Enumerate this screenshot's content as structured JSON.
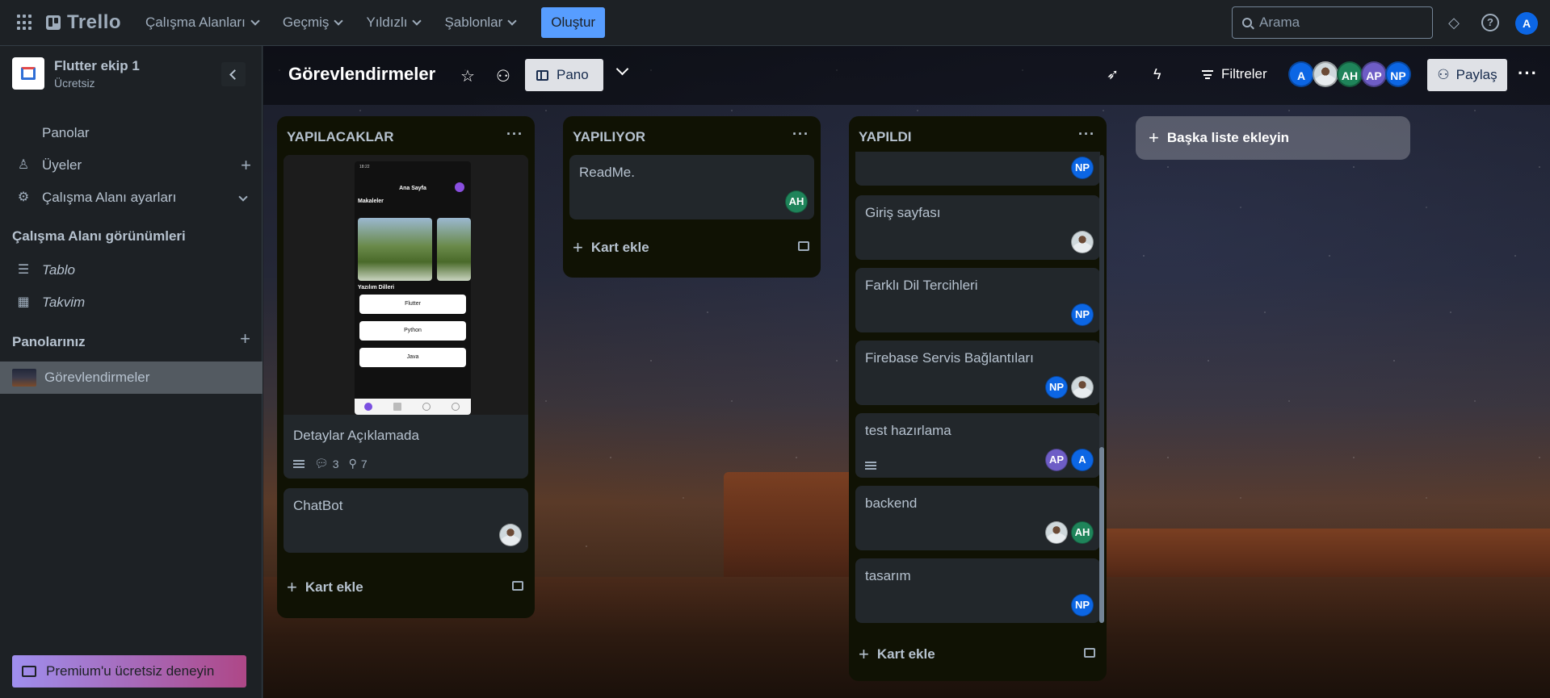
{
  "topbar": {
    "app_name": "Trello",
    "nav": [
      "Çalışma Alanları",
      "Geçmiş",
      "Yıldızlı",
      "Şablonlar"
    ],
    "create_label": "Oluştur",
    "search_placeholder": "Arama",
    "user_initial": "A"
  },
  "sidebar": {
    "workspace_name": "Flutter ekip 1",
    "workspace_plan": "Ücretsiz",
    "items": [
      "Panolar",
      "Üyeler",
      "Çalışma Alanı ayarları"
    ],
    "views_heading": "Çalışma Alanı görünümleri",
    "views": [
      "Tablo",
      "Takvim"
    ],
    "boards_heading": "Panolarınız",
    "boards": [
      "Görevlendirmeler"
    ],
    "premium_label": "Premium'u ücretsiz deneyin"
  },
  "board": {
    "title": "Görevlendirmeler",
    "view_label": "Pano",
    "filter_label": "Filtreler",
    "share_label": "Paylaş",
    "members": [
      "A",
      "",
      "AH",
      "AP",
      "NP"
    ],
    "add_list_label": "Başka liste ekleyin",
    "add_card_label": "Kart ekle"
  },
  "lists": [
    {
      "title": "YAPILACAKLAR",
      "cards": [
        {
          "title": "Detaylar Açıklamada",
          "comments": "3",
          "attachments": "7",
          "cover": {
            "status": "18:22",
            "screen_title": "Ana Sayfa",
            "section1": "Makaleler",
            "section2": "Yazılım Dilleri",
            "buttons": [
              "Flutter",
              "Python",
              "Java"
            ]
          }
        },
        {
          "title": "ChatBot",
          "members": [
            ""
          ]
        }
      ]
    },
    {
      "title": "YAPILIYOR",
      "cards": [
        {
          "title": "ReadMe.",
          "members": [
            "AH"
          ]
        }
      ]
    },
    {
      "title": "YAPILDI",
      "cards": [
        {
          "title": "",
          "members": [
            "NP"
          ]
        },
        {
          "title": "Giriş sayfası",
          "members": [
            ""
          ]
        },
        {
          "title": "Farklı Dil Tercihleri",
          "members": [
            "NP"
          ]
        },
        {
          "title": "Firebase Servis Bağlantıları",
          "members": [
            "NP",
            ""
          ]
        },
        {
          "title": "test hazırlama",
          "members": [
            "AP",
            "A"
          ]
        },
        {
          "title": "backend",
          "members": [
            "",
            "AH"
          ]
        },
        {
          "title": "tasarım",
          "members": [
            "NP"
          ]
        }
      ]
    }
  ],
  "colors": {
    "accent": "#579dff",
    "avatar_A": "#0c66e4",
    "avatar_AH": "#1f845a",
    "avatar_AP": "#6e5dc6",
    "avatar_NP": "#0c66e4"
  }
}
